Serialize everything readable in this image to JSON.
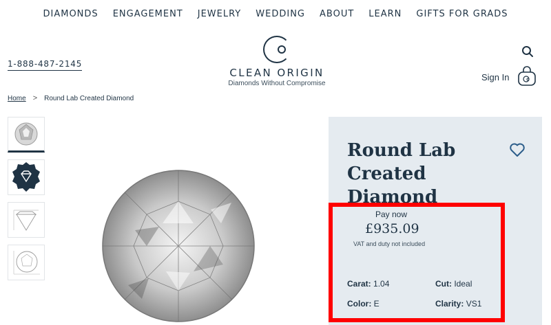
{
  "nav": {
    "items": [
      "DIAMONDS",
      "ENGAGEMENT",
      "JEWELRY",
      "WEDDING",
      "ABOUT",
      "LEARN",
      "GIFTS FOR GRADS"
    ]
  },
  "header": {
    "phone": "1-888-487-2145",
    "logo_name": "CLEAN ORIGIN",
    "logo_tagline": "Diamonds Without Compromise",
    "sign_in": "Sign In"
  },
  "breadcrumb": {
    "home": "Home",
    "separator": ">",
    "current": "Round Lab Created Diamond"
  },
  "product": {
    "title": "Round Lab Created Diamond",
    "pay_now_label": "Pay now",
    "price": "£935.09",
    "vat_note": "VAT and duty not included",
    "specs": {
      "carat_label": "Carat:",
      "carat_value": "1.04",
      "cut_label": "Cut:",
      "cut_value": "Ideal",
      "color_label": "Color:",
      "color_value": "E",
      "clarity_label": "Clarity:",
      "clarity_value": "VS1"
    }
  },
  "colors": {
    "brand_navy": "#1f3344",
    "panel_bg": "#e5ebf0",
    "highlight_red": "#ff0000",
    "heart_blue": "#2c5d8a"
  },
  "icons": [
    "search-icon",
    "shopping-bag-icon",
    "heart-icon",
    "chevron-right-icon",
    "diamond-badge-icon"
  ]
}
